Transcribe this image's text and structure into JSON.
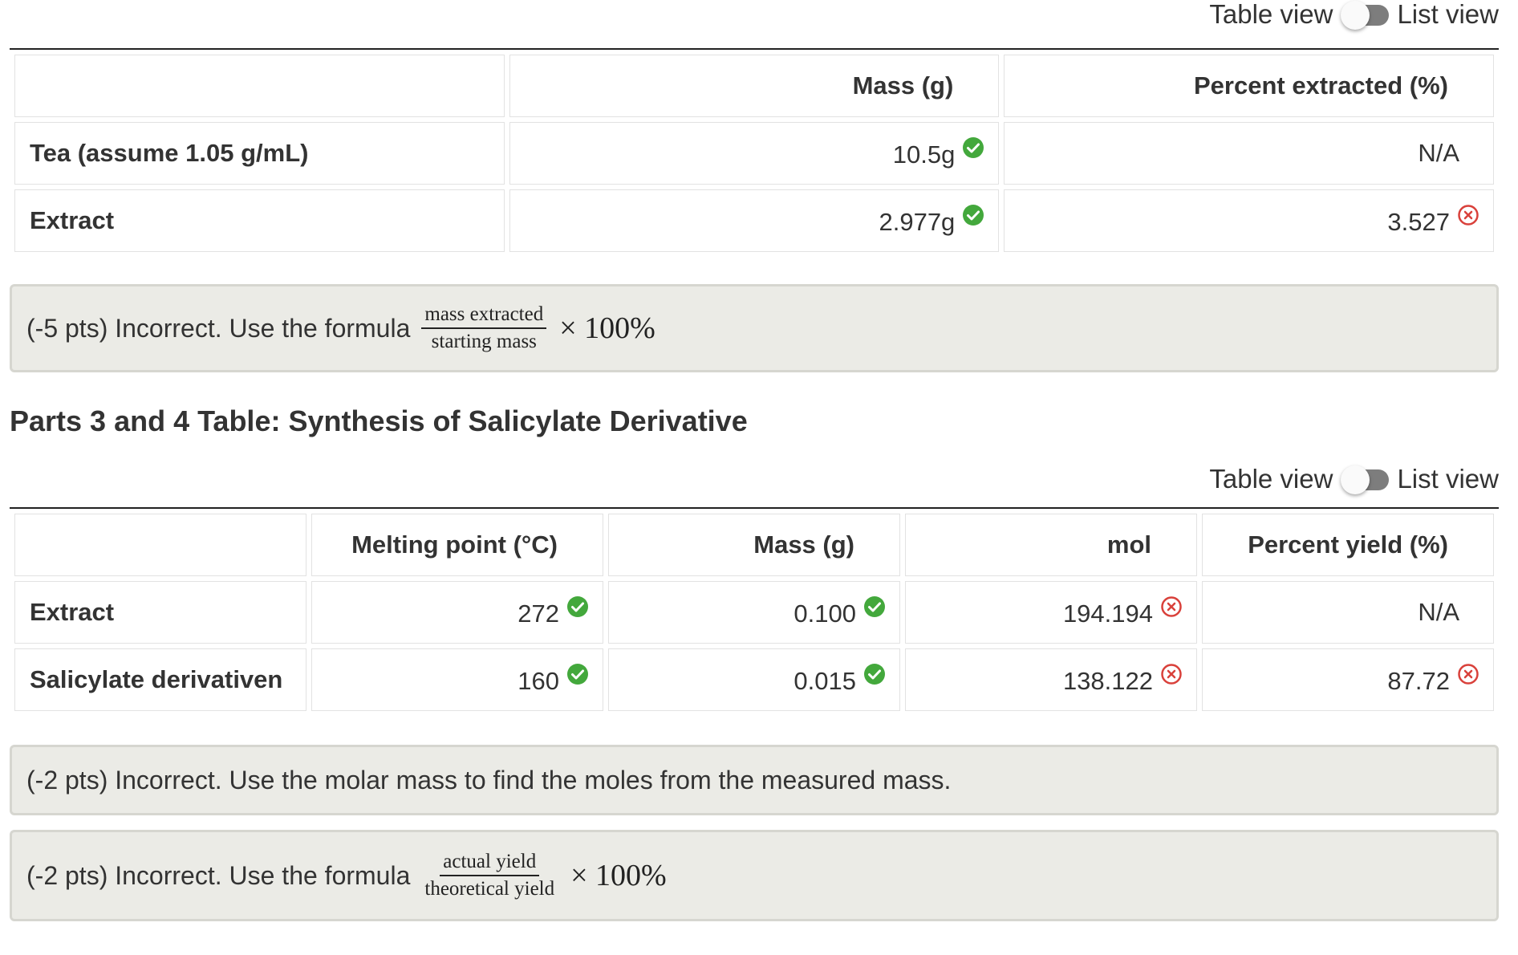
{
  "toggle_labels": {
    "table": "Table view",
    "list": "List view"
  },
  "icons": {
    "correct": "check-circle-icon",
    "incorrect": "x-circle-icon"
  },
  "colors": {
    "correct": "#43a83c",
    "incorrect": "#d9413b"
  },
  "table1": {
    "headers": [
      "",
      "Mass (g)",
      "Percent extracted (%)"
    ],
    "rows": [
      {
        "label": "Tea (assume 1.05 g/mL)",
        "mass": "10.5g",
        "percent": "N/A"
      },
      {
        "label": "Extract",
        "mass": "2.977g",
        "percent": "3.527"
      }
    ]
  },
  "feedback1": {
    "text": "(-5 pts) Incorrect. Use the formula",
    "numerator": "mass extracted",
    "denominator": "starting mass",
    "times": "× 100%"
  },
  "section2_title": "Parts 3 and 4 Table: Synthesis of Salicylate Derivative",
  "table2": {
    "headers": [
      "",
      "Melting point (°C)",
      "Mass (g)",
      "mol",
      "Percent yield (%)"
    ],
    "rows": [
      {
        "label": "Extract",
        "mp": "272",
        "mass": "0.100",
        "mol": "194.194",
        "yield": "N/A"
      },
      {
        "label": "Salicylate derivativen",
        "mp": "160",
        "mass": "0.015",
        "mol": "138.122",
        "yield": "87.72"
      }
    ]
  },
  "feedback2": {
    "text": "(-2 pts) Incorrect. Use the molar mass to find the moles from the measured mass."
  },
  "feedback3": {
    "text": "(-2 pts) Incorrect. Use the formula",
    "numerator": "actual yield",
    "denominator": "theoretical yield",
    "times": "× 100%"
  }
}
